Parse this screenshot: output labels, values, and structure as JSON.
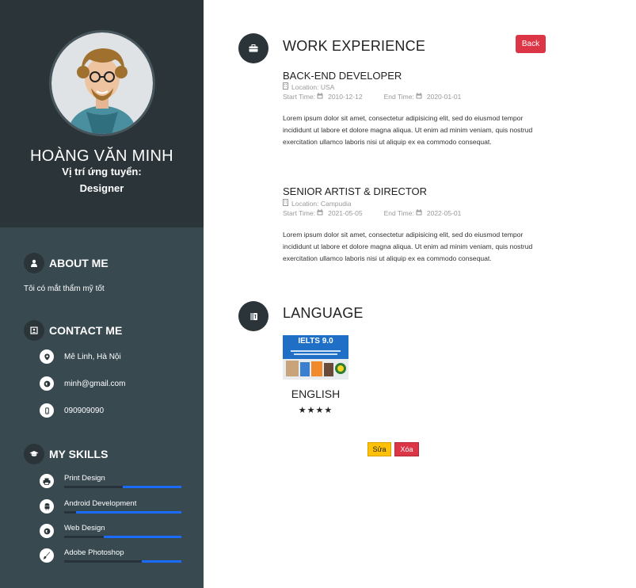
{
  "profile": {
    "name": "HOÀNG VĂN MINH",
    "position_label": "Vị trí ứng tuyển:",
    "position_value": "Designer"
  },
  "about": {
    "title": "ABOUT ME",
    "text": "Tôi có mắt thẩm mỹ tốt"
  },
  "contact": {
    "title": "CONTACT ME",
    "address": "Mê Linh, Hà Nội",
    "email": "minh@gmail.com",
    "phone": "090909090"
  },
  "skills": {
    "title": "MY SKILLS",
    "items": [
      {
        "label": "Print Design",
        "icon": "printer-icon",
        "level": 0.5
      },
      {
        "label": "Android Development",
        "icon": "android-icon",
        "level": 0.9
      },
      {
        "label": "Web Design",
        "icon": "globe-icon",
        "level": 0.66
      },
      {
        "label": "Adobe Photoshop",
        "icon": "brush-icon",
        "level": 0.34
      }
    ]
  },
  "work": {
    "title": "WORK EXPERIENCE",
    "back_label": "Back",
    "jobs": [
      {
        "title": "BACK-END DEVELOPER",
        "location": "Location: USA",
        "start_label": "Start Time:",
        "start": "2010-12-12",
        "end_label": "End Time:",
        "end": "2020-01-01",
        "desc": "Lorem ipsum dolor sit amet, consectetur adipisicing elit, sed do eiusmod tempor incididunt ut labore et dolore magna aliqua. Ut enim ad minim veniam, quis nostrud exercitation ullamco laboris nisi ut aliquip ex ea commodo consequat."
      },
      {
        "title": "SENIOR ARTIST & DIRECTOR",
        "location": "Location: Campudia",
        "start_label": "Start Time:",
        "start": "2021-05-05",
        "end_label": "End Time:",
        "end": "2022-05-01",
        "desc": "Lorem ipsum dolor sit amet, consectetur adipisicing elit, sed do eiusmod tempor incididunt ut labore et dolore magna aliqua. Ut enim ad minim veniam, quis nostrud exercitation ullamco laboris nisi ut aliquip ex ea commodo consequat."
      }
    ]
  },
  "language": {
    "title": "LANGUAGE",
    "image_text": "IELTS 9.0",
    "name": "ENGLISH",
    "stars": "★★★★",
    "rating": 4
  },
  "actions": {
    "edit_label": "Sửa",
    "delete_label": "Xóa"
  },
  "colors": {
    "sidebar_top": "#2b3439",
    "sidebar": "#384950",
    "accent_blue": "#1a6bff",
    "danger": "#dc3545",
    "warning": "#ffc107"
  }
}
